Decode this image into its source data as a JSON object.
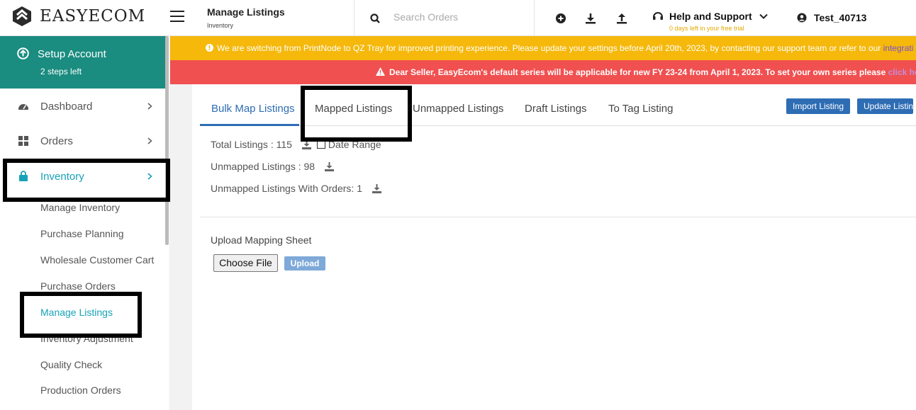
{
  "app": {
    "name": "EASYECOM"
  },
  "header": {
    "title": "Manage Listings",
    "subtitle": "Inventory",
    "search_placeholder": "Search Orders",
    "help_label": "Help and Support",
    "trial_text": "0 days left in your free trial",
    "user_name": "Test_40713"
  },
  "sidebar": {
    "setup_title": "Setup Account",
    "setup_sub": "2 steps left",
    "items": [
      {
        "label": "Dashboard",
        "icon": "dashboard-icon"
      },
      {
        "label": "Orders",
        "icon": "grid-icon"
      },
      {
        "label": "Inventory",
        "icon": "bag-icon"
      }
    ],
    "sub_items": [
      "Manage Inventory",
      "Purchase Planning",
      "Wholesale Customer Cart",
      "Purchase Orders",
      "Manage Listings",
      "Inventory Adjustment",
      "Quality Check",
      "Production Orders"
    ]
  },
  "banners": {
    "info": "We are switching from PrintNode to QZ Tray for improved printing experience. Please update your settings before April 20th, 2023, by contacting our support team or refer to our",
    "info_link": "integrati",
    "alert": "Dear Seller, EasyEcom's default series will be applicable for new FY 23-24 from April 1, 2023. To set your own series please",
    "alert_link": "click here"
  },
  "tabs": [
    "Bulk Map Listings",
    "Mapped Listings",
    "Unmapped Listings",
    "Draft Listings",
    "To Tag Listing"
  ],
  "buttons": {
    "import": "Import Listing",
    "update": "Update Listin"
  },
  "stats": {
    "total": "Total Listings : 115",
    "date_range": "Date Range",
    "unmapped": "Unmapped Listings : 98",
    "unmapped_orders": "Unmapped Listings With Orders: 1"
  },
  "upload": {
    "title": "Upload Mapping Sheet",
    "choose_label": "Choose File",
    "upload_label": "Upload"
  },
  "colors": {
    "teal": "#1a8c80",
    "accent": "#17a2b8",
    "warning": "#f5b80b",
    "danger": "#f05050",
    "primary": "#2e6db4"
  }
}
